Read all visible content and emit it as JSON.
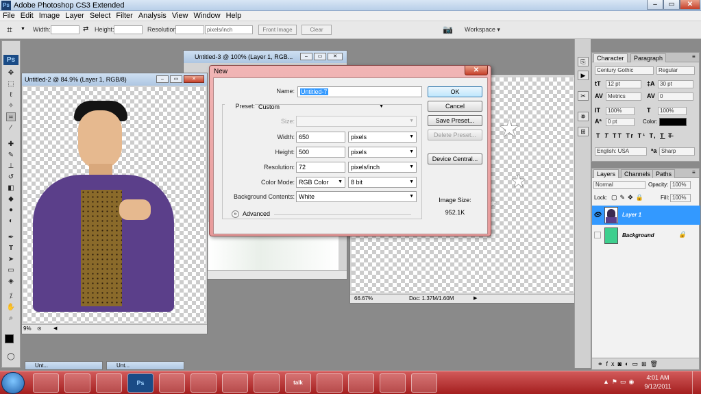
{
  "app": {
    "title": "Adobe Photoshop CS3 Extended"
  },
  "menu": [
    "File",
    "Edit",
    "Image",
    "Layer",
    "Select",
    "Filter",
    "Analysis",
    "View",
    "Window",
    "Help"
  ],
  "options_bar": {
    "width_label": "Width:",
    "height_label": "Height:",
    "resolution_label": "Resolution:",
    "resolution_unit": "pixels/inch",
    "front_image": "Front Image",
    "clear": "Clear",
    "workspace": "Workspace ▾"
  },
  "documents": {
    "doc2": {
      "title": "Untitled-2 @ 84.9% (Layer 1, RGB/8)",
      "zoom": "9%"
    },
    "doc3": {
      "title": "Untitled-3 @ 100% (Layer 1, RGB..."
    },
    "doc_right": {
      "zoom": "66.67%",
      "docsize": "Doc: 1.37M/1.60M"
    }
  },
  "minimized": [
    "Unt...",
    "Unt..."
  ],
  "dialog": {
    "title": "New",
    "name_label": "Name:",
    "name_value": "Untitled-7",
    "preset_label": "Preset:",
    "preset_value": "Custom",
    "size_label": "Size:",
    "width_label": "Width:",
    "width_value": "650",
    "width_unit": "pixels",
    "height_label": "Height:",
    "height_value": "500",
    "height_unit": "pixels",
    "resolution_label": "Resolution:",
    "resolution_value": "72",
    "resolution_unit": "pixels/inch",
    "colormode_label": "Color Mode:",
    "colormode_value": "RGB Color",
    "bitdepth_value": "8 bit",
    "bg_label": "Background Contents:",
    "bg_value": "White",
    "advanced": "Advanced",
    "ok": "OK",
    "cancel": "Cancel",
    "save_preset": "Save Preset...",
    "delete_preset": "Delete Preset...",
    "device_central": "Device Central...",
    "image_size_label": "Image Size:",
    "image_size_value": "952.1K"
  },
  "character_panel": {
    "tabs": [
      "Character",
      "Paragraph"
    ],
    "font": "Century Gothic",
    "style": "Regular",
    "size": "12 pt",
    "leading": "30 pt",
    "kerning": "Metrics",
    "tracking": "0",
    "vscale": "100%",
    "hscale": "100%",
    "baseline": "0 pt",
    "color_label": "Color:",
    "type_buttons": [
      "T",
      "T",
      "TT",
      "Tr",
      "T¹",
      "T,",
      "T",
      "T"
    ],
    "language": "English: USA",
    "aa_label": "ªa",
    "antialias": "Sharp"
  },
  "layers_panel": {
    "tabs": [
      "Layers",
      "Channels",
      "Paths"
    ],
    "blend": "Normal",
    "opacity_label": "Opacity:",
    "opacity": "100%",
    "lock_label": "Lock:",
    "fill_label": "Fill:",
    "fill": "100%",
    "layers": [
      {
        "name": "Layer 1",
        "selected": true
      },
      {
        "name": "Background",
        "selected": false
      }
    ],
    "colors": {
      "selected": "#3399ff",
      "background_thumb": "#3ecf8e"
    }
  },
  "taskbar": {
    "apps": [
      "",
      "",
      "",
      "Ps",
      "",
      "",
      "",
      "",
      "talk",
      "",
      "",
      "",
      ""
    ],
    "time": "4:01 AM",
    "date": "9/12/2011"
  }
}
